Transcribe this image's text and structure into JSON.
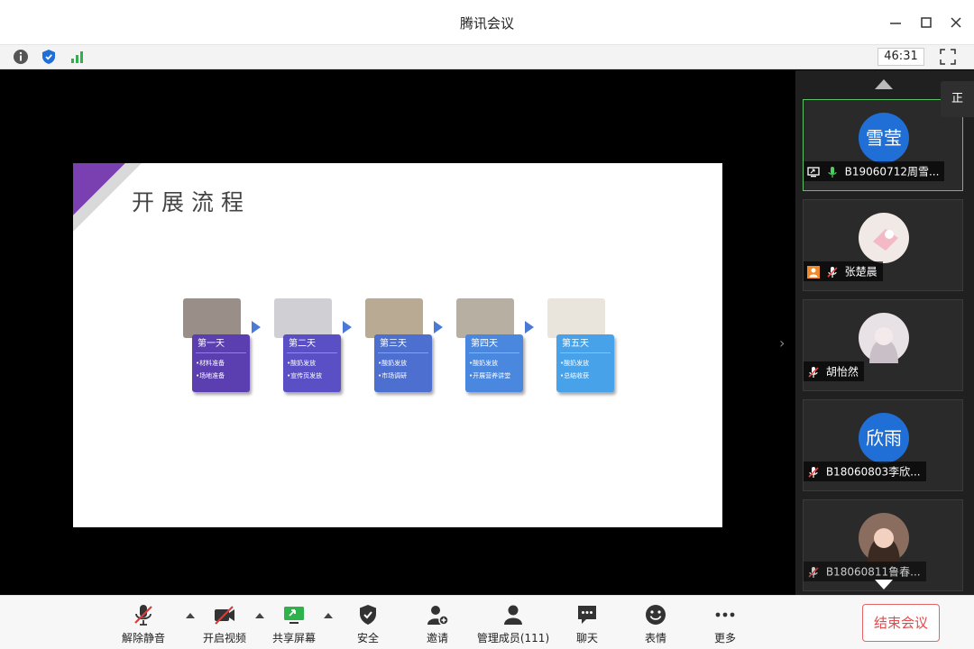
{
  "window": {
    "title": "腾讯会议",
    "timer": "46:31"
  },
  "slide": {
    "title": "开展流程",
    "steps": [
      {
        "day": "第一天",
        "items": [
          "•材料准备",
          "•场地准备"
        ],
        "color": "#5b3fb0",
        "photo": "#9a8e88"
      },
      {
        "day": "第二天",
        "items": [
          "•酸奶发放",
          "•宣传页发放"
        ],
        "color": "#5a4fc4",
        "photo": "#cfcfd4"
      },
      {
        "day": "第三天",
        "items": [
          "•酸奶发放",
          "•市场调研"
        ],
        "color": "#4d6fd0",
        "photo": "#b9ab93"
      },
      {
        "day": "第四天",
        "items": [
          "•酸奶发放",
          "•开展营养讲堂"
        ],
        "color": "#4a87df",
        "photo": "#b7b0a2"
      },
      {
        "day": "第五天",
        "items": [
          "•酸奶发放",
          "•总结收获"
        ],
        "color": "#47a2ea",
        "photo": "#e9e4dc"
      }
    ]
  },
  "participants": [
    {
      "name": "B19060712周雪...",
      "avatar_text": "雪莹",
      "avatar_color": "#1f6fd6",
      "active": true,
      "screen_share": true,
      "mic": "on"
    },
    {
      "name": "张楚晨",
      "avatar_text": "",
      "avatar_color": "#f1e9e6",
      "active": false,
      "host_badge": true,
      "mic": "muted"
    },
    {
      "name": "胡怡然",
      "avatar_text": "",
      "avatar_color": "#e8e2e6",
      "active": false,
      "mic": "muted"
    },
    {
      "name": "B18060803李欣...",
      "avatar_text": "欣雨",
      "avatar_color": "#1f6fd6",
      "active": false,
      "mic": "muted"
    },
    {
      "name": "B18060811鲁春...",
      "avatar_text": "",
      "avatar_color": "#8a6d5e",
      "active": false,
      "mic": "muted"
    }
  ],
  "tooltip": {
    "text": "正在"
  },
  "toolbar": {
    "unmute": "解除静音",
    "video": "开启视频",
    "share": "共享屏幕",
    "security": "安全",
    "invite": "邀请",
    "members": "管理成员(111)",
    "chat": "聊天",
    "reactions": "表情",
    "more": "更多",
    "end": "结束会议"
  }
}
